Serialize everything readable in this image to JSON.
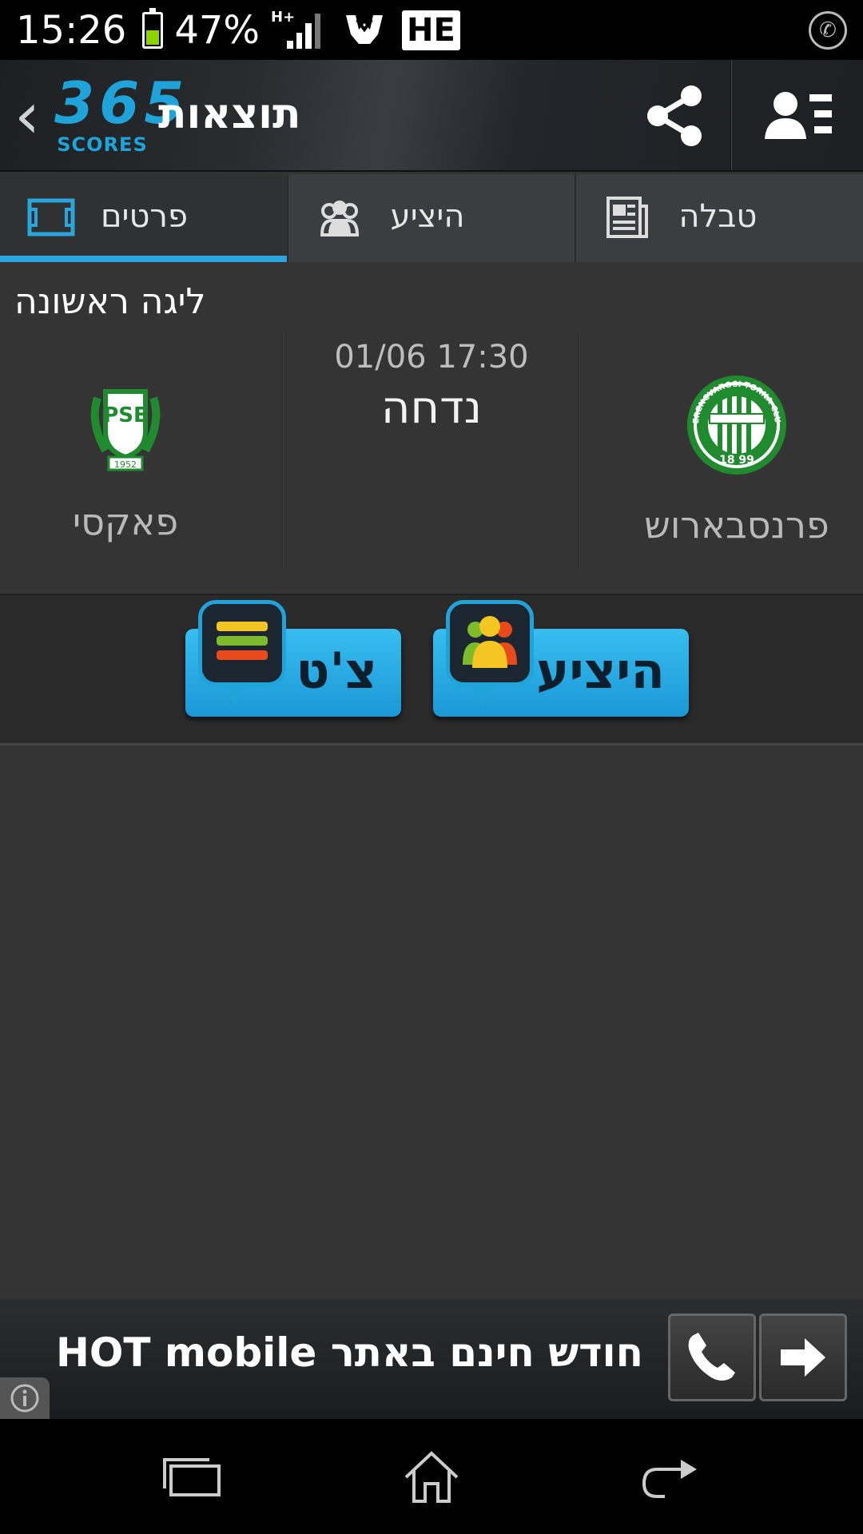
{
  "status_bar": {
    "time": "15:26",
    "battery_percent": "47%",
    "battery_level": 0.47,
    "network_type": "H+",
    "keyboard_lang": "HE"
  },
  "header": {
    "logo_number": "365",
    "logo_text": "SCORES",
    "title": "תוצאות"
  },
  "tabs": [
    {
      "label": "פרטים",
      "icon": "field-icon",
      "active": true
    },
    {
      "label": "היציע",
      "icon": "users-icon",
      "active": false
    },
    {
      "label": "טבלה",
      "icon": "news-icon",
      "active": false
    }
  ],
  "match": {
    "league": "ליגה ראשונה",
    "datetime": "01/06 17:30",
    "status": "נדחה",
    "home_team": {
      "name": "פרנסבארוש",
      "logo_text": "FERENCVAROSI TORNA CLUB",
      "logo_year": "18 99"
    },
    "away_team": {
      "name": "פאקסי",
      "logo_text": "PSE",
      "logo_year": "1952"
    }
  },
  "actions": {
    "stands_label": "היציע",
    "chat_label": "צ'ט"
  },
  "ad": {
    "text": "חודש חינם באתר HOT mobile"
  },
  "colors": {
    "accent": "#2aa5dd",
    "button_blue": "#1fa3d8",
    "team_green": "#1f8b2e"
  }
}
